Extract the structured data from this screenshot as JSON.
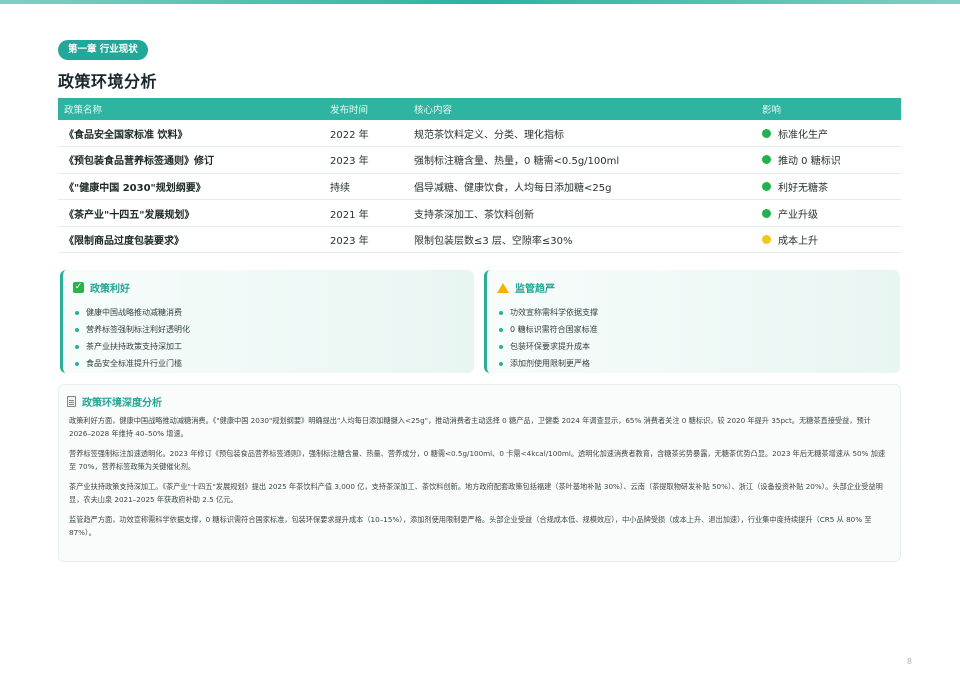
{
  "chapter_badge": "第一章 行业现状",
  "page_title": "政策环境分析",
  "table": {
    "headers": [
      "政策名称",
      "发布时间",
      "核心内容",
      "影响"
    ],
    "rows": [
      {
        "name": "《食品安全国家标准 饮料》",
        "date": "2022 年",
        "core": "规范茶饮料定义、分类、理化指标",
        "impact": "标准化生产",
        "impact_color": "#22b14c"
      },
      {
        "name": "《预包装食品营养标签通则》修订",
        "date": "2023 年",
        "core": "强制标注糖含量、热量，0 糖需<0.5g/100ml",
        "impact": "推动 0 糖标识",
        "impact_color": "#22b14c"
      },
      {
        "name": "《\"健康中国 2030\"规划纲要》",
        "date": "持续",
        "core": "倡导减糖、健康饮食，人均每日添加糖<25g",
        "impact": "利好无糖茶",
        "impact_color": "#22b14c"
      },
      {
        "name": "《茶产业\"十四五\"发展规划》",
        "date": "2021 年",
        "core": "支持茶深加工、茶饮料创新",
        "impact": "产业升级",
        "impact_color": "#22b14c"
      },
      {
        "name": "《限制商品过度包装要求》",
        "date": "2023 年",
        "core": "限制包装层数≤3 层、空隙率≤30%",
        "impact": "成本上升",
        "impact_color": "#f5c518"
      }
    ]
  },
  "benefits": {
    "title": "政策利好",
    "icon": "check-icon",
    "items": [
      "健康中国战略推动减糖消费",
      "营养标签强制标注利好透明化",
      "茶产业扶持政策支持深加工",
      "食品安全标准提升行业门槛"
    ]
  },
  "regulation": {
    "title": "监管趋严",
    "icon": "warning-icon",
    "items": [
      "功效宣称需科学依据支撑",
      "0 糖标识需符合国家标准",
      "包装环保要求提升成本",
      "添加剂使用限制更严格"
    ]
  },
  "analysis": {
    "title": "政策环境深度分析",
    "icon": "document-icon",
    "paragraphs": [
      "政策利好方面，健康中国战略推动减糖消费。《\"健康中国 2030\"规划纲要》明确提出\"人均每日添加糖摄入<25g\"，推动消费者主动选择 0 糖产品，卫健委 2024 年调查显示，65% 消费者关注 0 糖标识，较 2020 年提升 35pct。无糖茶直接受益，预计 2026–2028 年维持 40–50% 增速。",
      "营养标签强制标注加速透明化。2023 年修订《预包装食品营养标签通则》，强制标注糖含量、热量、营养成分，0 糖需<0.5g/100ml、0 卡需<4kcal/100ml。透明化加速消费者教育，含糖茶劣势暴露，无糖茶优势凸显。2023 年后无糖茶增速从 50% 加速至 70%，营养标签政策为关键催化剂。",
      "茶产业扶持政策支持深加工。《茶产业\"十四五\"发展规划》提出 2025 年茶饮料产值 3,000 亿，支持茶深加工、茶饮料创新。地方政府配套政策包括福建（茶叶基地补贴 30%）、云南（茶提取物研发补贴 50%）、浙江（设备投资补贴 20%）。头部企业受益明显，农夫山泉 2021–2025 年获政府补助 2.5 亿元。",
      "监管趋严方面，功效宣称需科学依据支撑，0 糖标识需符合国家标准，包装环保要求提升成本（10–15%），添加剂使用限制更严格。头部企业受益（合规成本低、规模效应），中小品牌受损（成本上升、退出加速），行业集中度持续提升（CR5 从 80% 至 87%）。"
    ]
  },
  "page_number": "8",
  "colors": {
    "accent": "#2eb4a1",
    "green": "#22b14c",
    "yellow": "#f5c518"
  }
}
